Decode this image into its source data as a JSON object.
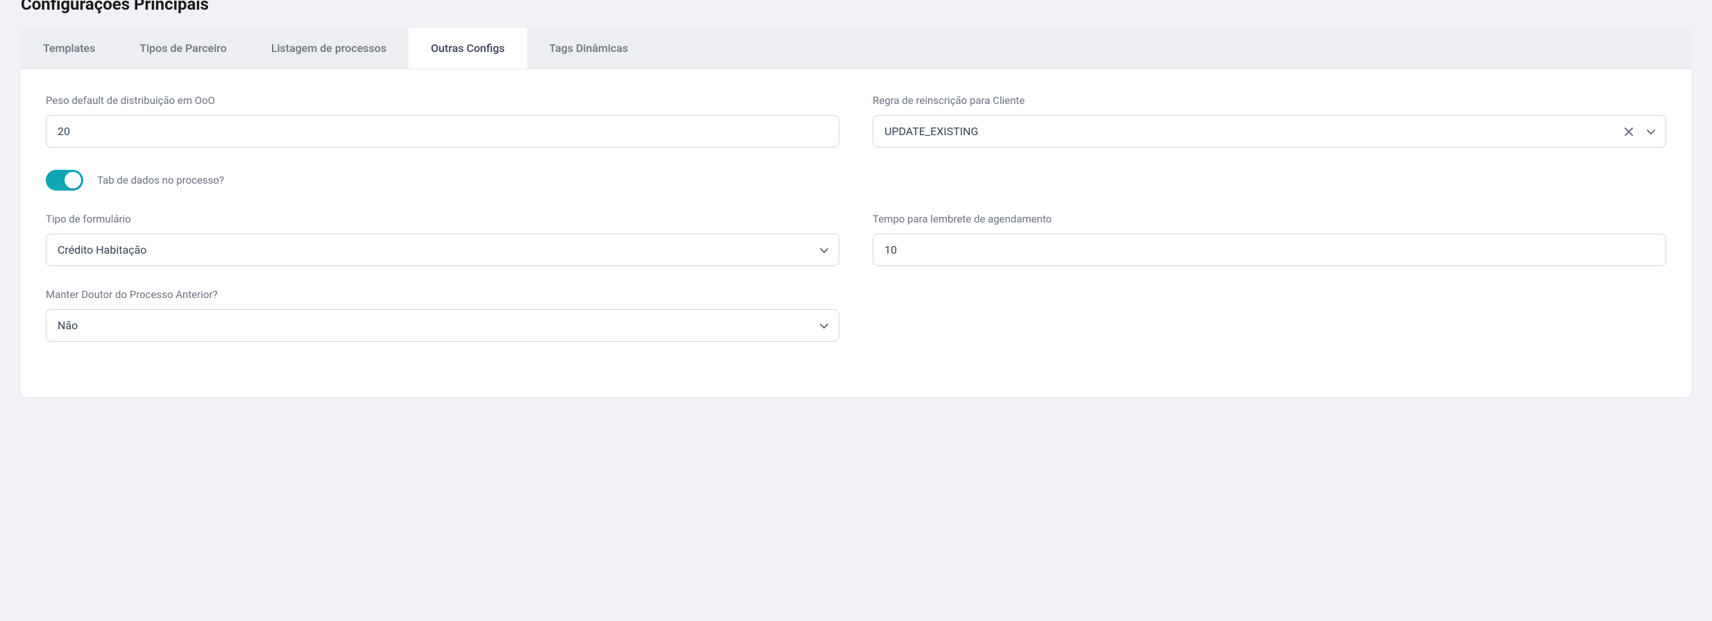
{
  "pageTitle": "Configurações Principais",
  "tabs": {
    "templates": "Templates",
    "tiposParceiro": "Tipos de Parceiro",
    "listagemProcessos": "Listagem de processos",
    "outrasConfigs": "Outras Configs",
    "tagsDinamicas": "Tags Dinâmicas"
  },
  "fields": {
    "pesoDefault": {
      "label": "Peso default de distribuição em OoO",
      "value": "20"
    },
    "regraReinscricao": {
      "label": "Regra de reinscrição para Cliente",
      "value": "UPDATE_EXISTING"
    },
    "tabDadosProcesso": {
      "label": "Tab de dados no processo?"
    },
    "tipoFormulario": {
      "label": "Tipo de formulário",
      "value": "Crédito Habitação"
    },
    "tempoLembrete": {
      "label": "Tempo para lembrete de agendamento",
      "value": "10"
    },
    "manterDoutor": {
      "label": "Manter Doutor do Processo Anterior?",
      "value": "Não"
    }
  }
}
